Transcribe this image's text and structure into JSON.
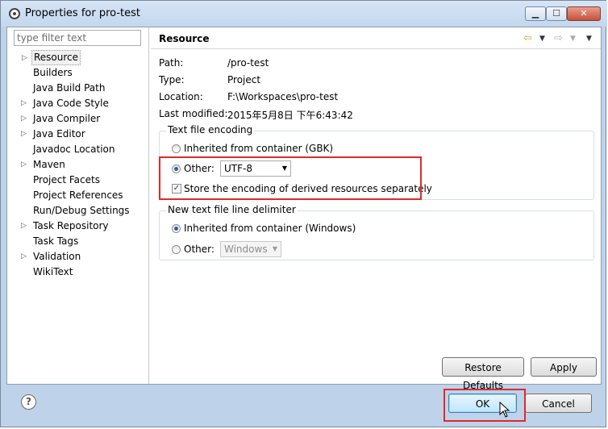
{
  "window": {
    "title": "Properties for pro-test",
    "minimize": "▁",
    "maximize": "☐",
    "close": "✕"
  },
  "filter": {
    "placeholder": "type filter text",
    "value": ""
  },
  "tree": [
    {
      "label": "Resource",
      "expandable": true,
      "selected": true
    },
    {
      "label": "Builders",
      "expandable": false
    },
    {
      "label": "Java Build Path",
      "expandable": false
    },
    {
      "label": "Java Code Style",
      "expandable": true
    },
    {
      "label": "Java Compiler",
      "expandable": true
    },
    {
      "label": "Java Editor",
      "expandable": true
    },
    {
      "label": "Javadoc Location",
      "expandable": false
    },
    {
      "label": "Maven",
      "expandable": true
    },
    {
      "label": "Project Facets",
      "expandable": false
    },
    {
      "label": "Project References",
      "expandable": false
    },
    {
      "label": "Run/Debug Settings",
      "expandable": false
    },
    {
      "label": "Task Repository",
      "expandable": true
    },
    {
      "label": "Task Tags",
      "expandable": false
    },
    {
      "label": "Validation",
      "expandable": true
    },
    {
      "label": "WikiText",
      "expandable": false
    }
  ],
  "page": {
    "title": "Resource",
    "props": [
      {
        "label": "Path:",
        "value": "/pro-test"
      },
      {
        "label": "Type:",
        "value": "Project"
      },
      {
        "label": "Location:",
        "value": "F:\\Workspaces\\pro-test"
      },
      {
        "label": "Last modified:",
        "value": "2015年5月8日 下午6:43:42"
      }
    ],
    "encoding": {
      "group_label": "Text file encoding",
      "inherited_label": "Inherited from container (GBK)",
      "other_label": "Other:",
      "other_value": "UTF-8",
      "store_label": "Store the encoding of derived resources separately",
      "store_checked": true,
      "selected": "other"
    },
    "delimiter": {
      "group_label": "New text file line delimiter",
      "inherited_label": "Inherited from container (Windows)",
      "other_label": "Other:",
      "other_value": "Windows",
      "selected": "inherited"
    },
    "restore_label": "Restore Defaults",
    "apply_label": "Apply"
  },
  "footer": {
    "help_label": "?",
    "ok_label": "OK",
    "cancel_label": "Cancel"
  },
  "icons": [
    "app-gear-icon",
    "back-arrow-icon",
    "forward-arrow-icon",
    "dropdown-arrow-icon",
    "help-icon",
    "mouse-cursor-icon"
  ],
  "colors": {
    "highlight_box": "#e02a2a",
    "titlebar": "#c3d7ee",
    "default_button": "#bee6fd"
  }
}
